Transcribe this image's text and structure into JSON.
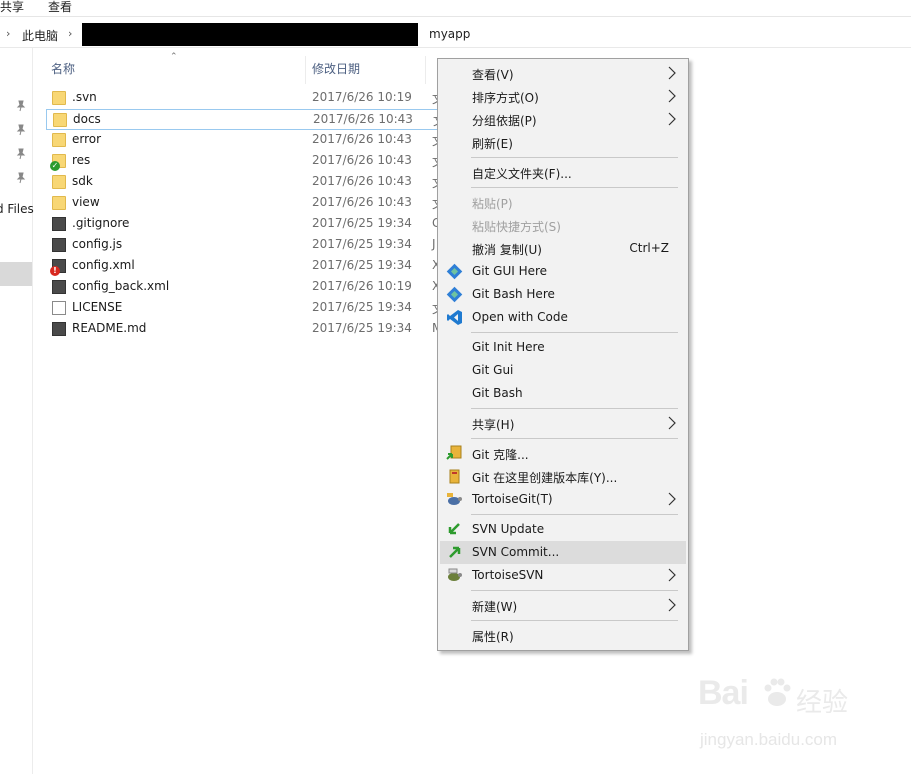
{
  "ribbon": {
    "tabs": [
      "共享",
      "查看"
    ]
  },
  "address": {
    "crumbs": [
      "此电脑",
      "myapp"
    ]
  },
  "nav": {
    "partial_label": "d Files"
  },
  "columns": {
    "name": "名称",
    "modified": "修改日期"
  },
  "files": [
    {
      "name": ".svn",
      "modified": "2017/6/26 10:19",
      "type_initial": "文",
      "icon": "folder-icon",
      "badge": ""
    },
    {
      "name": "docs",
      "modified": "2017/6/26 10:43",
      "type_initial": "文",
      "icon": "folder-icon",
      "badge": ""
    },
    {
      "name": "error",
      "modified": "2017/6/26 10:43",
      "type_initial": "文",
      "icon": "folder-icon",
      "badge": ""
    },
    {
      "name": "res",
      "modified": "2017/6/26 10:43",
      "type_initial": "文",
      "icon": "folder-icon",
      "badge": "svn-normal-check-icon"
    },
    {
      "name": "sdk",
      "modified": "2017/6/26 10:43",
      "type_initial": "文",
      "icon": "folder-icon",
      "badge": ""
    },
    {
      "name": "view",
      "modified": "2017/6/26 10:43",
      "type_initial": "文",
      "icon": "folder-icon",
      "badge": ""
    },
    {
      "name": ".gitignore",
      "modified": "2017/6/25 19:34",
      "type_initial": "G",
      "icon": "text-file-icon",
      "badge": ""
    },
    {
      "name": "config.js",
      "modified": "2017/6/25 19:34",
      "type_initial": "J",
      "icon": "js-file-icon",
      "badge": ""
    },
    {
      "name": "config.xml",
      "modified": "2017/6/25 19:34",
      "type_initial": "X",
      "icon": "xml-file-icon",
      "badge": "svn-modified-icon"
    },
    {
      "name": "config_back.xml",
      "modified": "2017/6/26 10:19",
      "type_initial": "X",
      "icon": "xml-file-icon",
      "badge": ""
    },
    {
      "name": "LICENSE",
      "modified": "2017/6/25 19:34",
      "type_initial": "文",
      "icon": "blank-file-icon",
      "badge": ""
    },
    {
      "name": "README.md",
      "modified": "2017/6/25 19:34",
      "type_initial": "M",
      "icon": "md-file-icon",
      "badge": ""
    }
  ],
  "context_menu": {
    "items": [
      {
        "label": "查看(V)",
        "submenu": true
      },
      {
        "label": "排序方式(O)",
        "submenu": true
      },
      {
        "label": "分组依据(P)",
        "submenu": true
      },
      {
        "label": "刷新(E)"
      },
      {
        "label": "自定义文件夹(F)..."
      },
      {
        "label": "粘贴(P)",
        "disabled": true
      },
      {
        "label": "粘贴快捷方式(S)",
        "disabled": true
      },
      {
        "label": "撤消 复制(U)",
        "shortcut": "Ctrl+Z"
      },
      {
        "label": "Git GUI Here",
        "icon": "git-icon"
      },
      {
        "label": "Git Bash Here",
        "icon": "git-icon"
      },
      {
        "label": "Open with Code",
        "icon": "vscode-icon"
      },
      {
        "label": "Git Init Here"
      },
      {
        "label": "Git Gui"
      },
      {
        "label": "Git Bash"
      },
      {
        "label": "共享(H)",
        "submenu": true
      },
      {
        "label": "Git 克隆...",
        "icon": "tortoisegit-clone-icon"
      },
      {
        "label": "Git 在这里创建版本库(Y)...",
        "icon": "tortoisegit-create-repo-icon"
      },
      {
        "label": "TortoiseGit(T)",
        "icon": "tortoisegit-icon",
        "submenu": true
      },
      {
        "label": "SVN Update",
        "icon": "svn-update-icon"
      },
      {
        "label": "SVN Commit...",
        "icon": "svn-commit-icon",
        "highlighted": true
      },
      {
        "label": "TortoiseSVN",
        "icon": "tortoisesvn-icon",
        "submenu": true
      },
      {
        "label": "新建(W)",
        "submenu": true
      },
      {
        "label": "属性(R)"
      }
    ]
  },
  "watermark": {
    "brand": "Bai",
    "brand_suffix": "经验",
    "site": "jingyan.baidu.com"
  },
  "colors": {
    "selection_border": "#99c9ef",
    "menu_bg": "#f2f2f2",
    "menu_hover": "#dcdcdc",
    "folder": "#f8d775",
    "column_header": "#4d6082"
  }
}
